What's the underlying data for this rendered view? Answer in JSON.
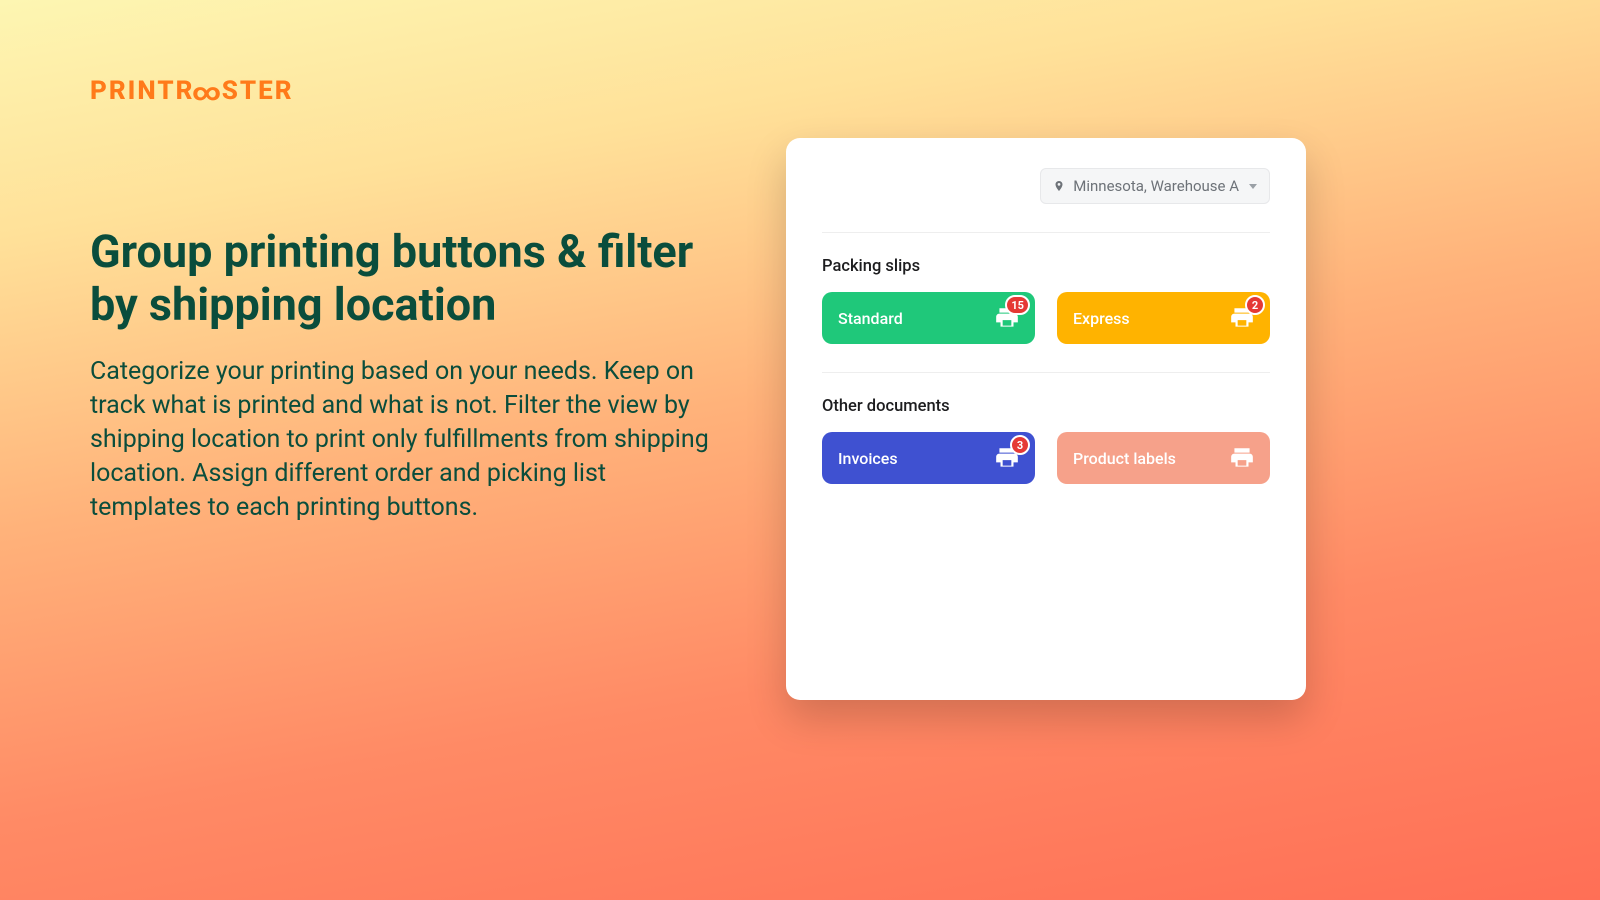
{
  "brand": {
    "name_left": "PRINTR",
    "name_right": "STER"
  },
  "hero": {
    "title": "Group printing buttons & filter by shipping location",
    "body": "Categorize your printing based on your needs. Keep on track what is printed and what is not. Filter the view by shipping location to print only fulfillments from shipping location. Assign different order and picking list templates to each printing buttons."
  },
  "card": {
    "location_label": "Minnesota, Warehouse A",
    "sections": [
      {
        "title": "Packing slips",
        "buttons": [
          {
            "label": "Standard",
            "count": "15",
            "color": "#1fc87a",
            "has_badge": true
          },
          {
            "label": "Express",
            "count": "2",
            "color": "#ffb300",
            "has_badge": true
          }
        ]
      },
      {
        "title": "Other documents",
        "buttons": [
          {
            "label": "Invoices",
            "count": "3",
            "color": "#3f51d1",
            "has_badge": true
          },
          {
            "label": "Product labels",
            "count": "",
            "color": "#f6a18a",
            "has_badge": false
          }
        ]
      }
    ]
  }
}
